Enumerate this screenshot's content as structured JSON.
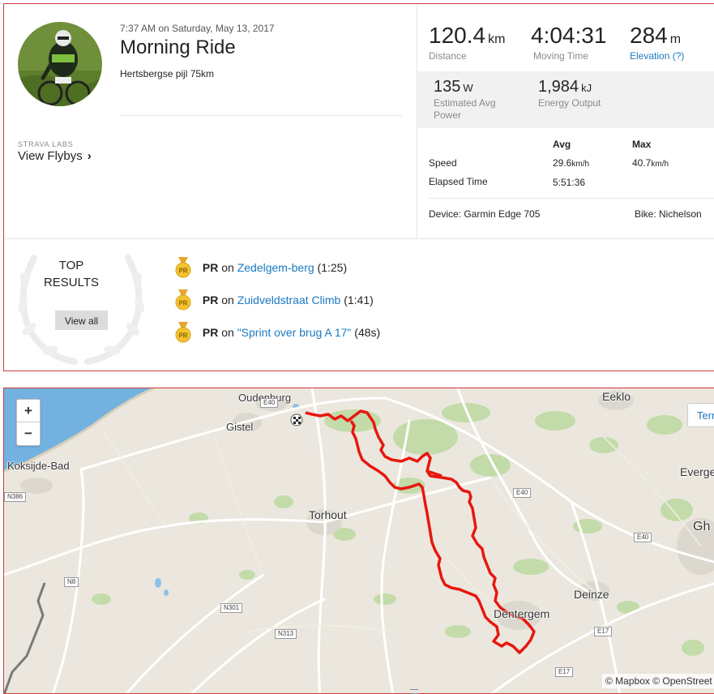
{
  "activity": {
    "datetime": "7:37 AM on Saturday, May 13, 2017",
    "title": "Morning Ride",
    "description": "Hertsbergse pijl 75km"
  },
  "labs": {
    "label": "STRAVA LABS",
    "flybys": "View Flybys",
    "chevron": "›"
  },
  "stats": {
    "distance": {
      "value": "120.4",
      "unit": "km",
      "label": "Distance"
    },
    "moving_time": {
      "value": "4:04:31",
      "label": "Moving Time"
    },
    "elevation": {
      "value": "284",
      "unit": "m",
      "label": "Elevation (?)"
    },
    "power": {
      "value": "135",
      "unit": "W",
      "label": "Estimated Avg Power"
    },
    "energy": {
      "value": "1,984",
      "unit": "kJ",
      "label": "Energy Output"
    }
  },
  "table": {
    "col_avg": "Avg",
    "col_max": "Max",
    "rows": [
      {
        "label": "Speed",
        "avg": "29.6",
        "avg_unit": "km/h",
        "max": "40.7",
        "max_unit": "km/h"
      },
      {
        "label": "Elapsed Time",
        "avg": "5:51:36"
      }
    ],
    "device": "Device: Garmin Edge 705",
    "bike": "Bike: Nichelson"
  },
  "top_results": {
    "heading": "TOP RESULTS",
    "view_all": "View all",
    "medal_text": "PR",
    "items": [
      {
        "badge": "PR",
        "on": "on",
        "segment": "Zedelgem-berg",
        "time": "(1:25)"
      },
      {
        "badge": "PR",
        "on": "on",
        "segment": "Zuidveldstraat Climb",
        "time": "(1:41)"
      },
      {
        "badge": "PR",
        "on": "on",
        "segment": "\"Sprint over brug A 17\"",
        "time": "(48s)"
      }
    ]
  },
  "map": {
    "zoom_in": "+",
    "zoom_out": "−",
    "terrain_button": "Terr",
    "attribution": "© Mapbox © OpenStreet",
    "towns": {
      "oudenburg": "Oudenburg",
      "gistel": "Gistel",
      "koksijde": "Koksijde-Bad",
      "torhout": "Torhout",
      "eeklo": "Eeklo",
      "everge": "Everge",
      "gh": "Gh",
      "deinze": "Deinze",
      "dentergem": "Dentergem"
    },
    "roads": {
      "e40a": "E40",
      "e40b": "E40",
      "e40c": "E40",
      "e17a": "E17",
      "e17b": "E17",
      "n8": "N8",
      "n301": "N301",
      "n313": "N313",
      "n386": "N386"
    },
    "colors": {
      "route": "#e8170f",
      "land": "#ebe7de",
      "sea": "#73b1e1",
      "green": "#b8d69a"
    }
  }
}
